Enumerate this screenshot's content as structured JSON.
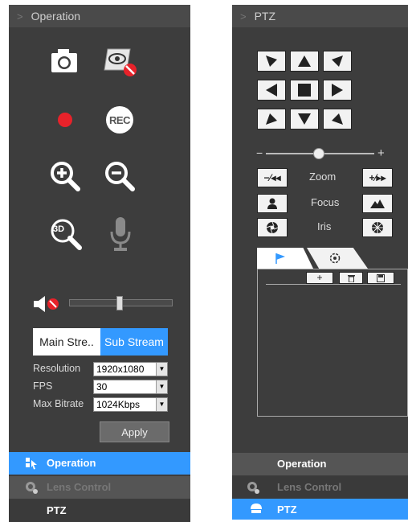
{
  "left_panel": {
    "header_title": "Operation",
    "stream_tabs": [
      "Main Stre..",
      "Sub Stream"
    ],
    "rec_label": "REC",
    "three_d_label": "3D",
    "settings": [
      {
        "label": "Resolution",
        "value": "1920x1080"
      },
      {
        "label": "FPS",
        "value": "30"
      },
      {
        "label": "Max Bitrate",
        "value": "1024Kbps"
      }
    ],
    "apply_label": "Apply",
    "volume_level": 0.48,
    "tabs": [
      "Operation",
      "Lens Control",
      "PTZ"
    ]
  },
  "right_panel": {
    "header_title": "PTZ",
    "zoom_label": "Zoom",
    "focus_label": "Focus",
    "iris_label": "Iris",
    "speed_minus": "−",
    "speed_plus": "+",
    "speed_level": 0.48,
    "tabs": [
      "Operation",
      "Lens Control",
      "PTZ"
    ]
  },
  "colors": {
    "panel_bg": "#3d3d3d",
    "accent": "#3399ff",
    "record_red": "#e8222a",
    "forbid_red": "#e8222a"
  }
}
